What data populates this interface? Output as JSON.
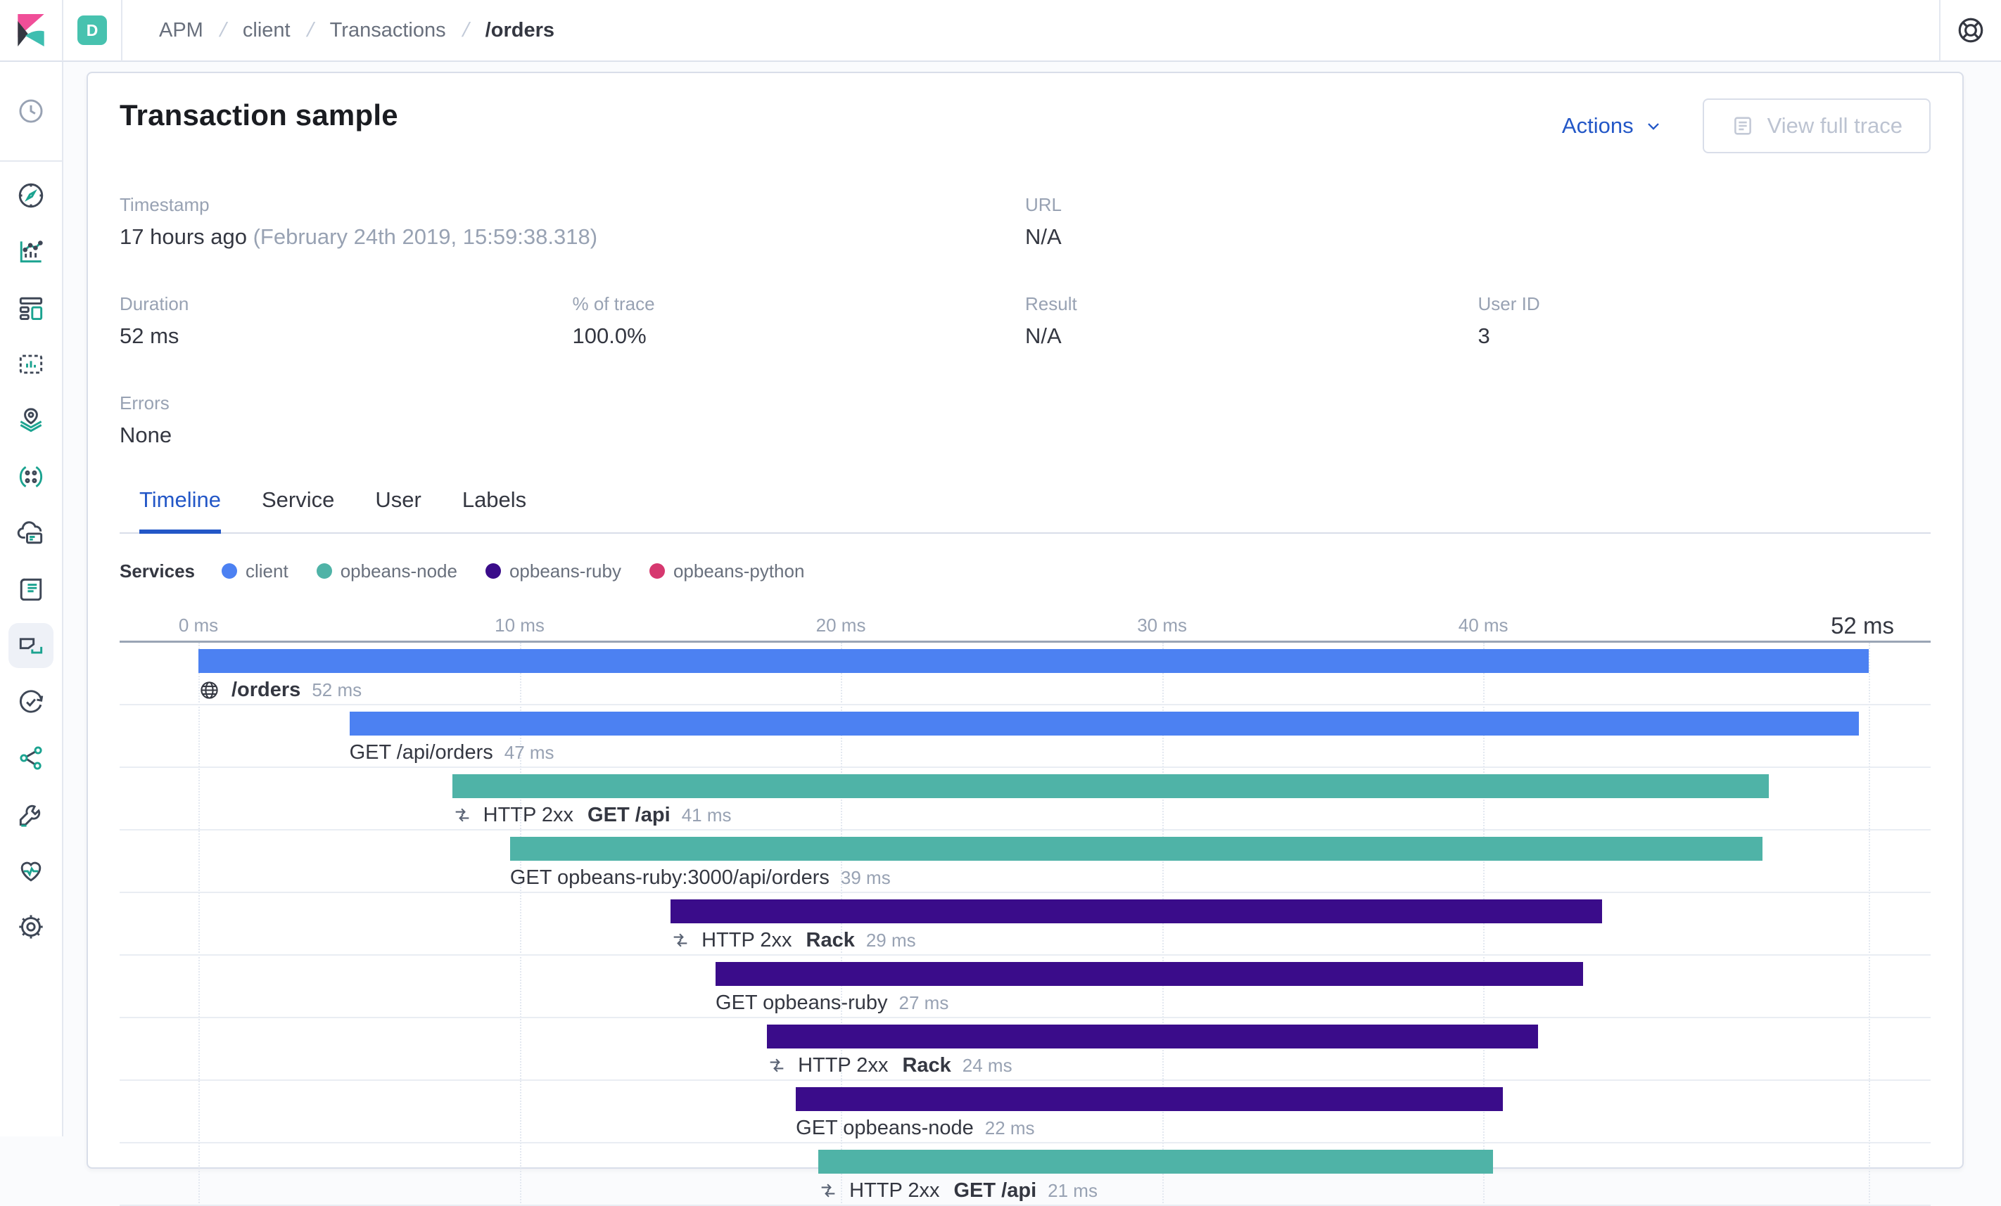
{
  "topbar": {
    "space_badge": "D",
    "breadcrumbs": [
      "APM",
      "client",
      "Transactions",
      "/orders"
    ]
  },
  "sidebar": {
    "items": [
      {
        "name": "recently-viewed",
        "icon": "clock"
      },
      {
        "name": "discover",
        "icon": "compass"
      },
      {
        "name": "visualize",
        "icon": "visualize"
      },
      {
        "name": "dashboard",
        "icon": "dashboard"
      },
      {
        "name": "canvas",
        "icon": "canvas"
      },
      {
        "name": "maps",
        "icon": "maps"
      },
      {
        "name": "machine-learning",
        "icon": "machine-learning"
      },
      {
        "name": "infrastructure",
        "icon": "infrastructure"
      },
      {
        "name": "logs",
        "icon": "logs"
      },
      {
        "name": "apm",
        "icon": "apm",
        "active": true
      },
      {
        "name": "uptime",
        "icon": "uptime"
      },
      {
        "name": "graph",
        "icon": "graph"
      },
      {
        "name": "dev-tools",
        "icon": "dev-tools"
      },
      {
        "name": "monitoring",
        "icon": "monitoring"
      },
      {
        "name": "management",
        "icon": "management"
      }
    ]
  },
  "panel": {
    "title": "Transaction sample",
    "actions_label": "Actions",
    "view_full_trace_label": "View full trace",
    "meta": {
      "timestamp": {
        "label": "Timestamp",
        "value": "17 hours ago",
        "value_secondary": "(February 24th 2019, 15:59:38.318)"
      },
      "url": {
        "label": "URL",
        "value": "N/A"
      },
      "duration": {
        "label": "Duration",
        "value": "52 ms"
      },
      "trace_pct": {
        "label": "% of trace",
        "value": "100.0%"
      },
      "result": {
        "label": "Result",
        "value": "N/A"
      },
      "user_id": {
        "label": "User ID",
        "value": "3"
      },
      "errors": {
        "label": "Errors",
        "value": "None"
      }
    }
  },
  "tabs": {
    "items": [
      {
        "label": "Timeline",
        "active": true
      },
      {
        "label": "Service",
        "active": false
      },
      {
        "label": "User",
        "active": false
      },
      {
        "label": "Labels",
        "active": false
      }
    ]
  },
  "timeline": {
    "legend_title": "Services",
    "legend": [
      {
        "label": "client",
        "color": "#4c81f2"
      },
      {
        "label": "opbeans-node",
        "color": "#4fb3a7"
      },
      {
        "label": "opbeans-ruby",
        "color": "#3a0c8a"
      },
      {
        "label": "opbeans-python",
        "color": "#d6386f"
      }
    ]
  },
  "colors": {
    "client": "#4c81f2",
    "opbeans-node": "#4fb3a7",
    "opbeans-ruby": "#3a0c8a",
    "opbeans-python": "#d6386f",
    "accent_blue": "#2357c7"
  },
  "chart_data": {
    "type": "bar",
    "subtype": "waterfall-gantt",
    "title": "Transaction timeline waterfall",
    "xlabel": "ms",
    "xlim": [
      0,
      52
    ],
    "grid": true,
    "ticks": [
      {
        "value": 0,
        "label": "0 ms"
      },
      {
        "value": 10,
        "label": "10 ms"
      },
      {
        "value": 20,
        "label": "20 ms"
      },
      {
        "value": 30,
        "label": "30 ms"
      },
      {
        "value": 40,
        "label": "40 ms"
      }
    ],
    "total_label": "52 ms",
    "items": [
      {
        "name": "/orders",
        "bold": true,
        "icon": "globe",
        "service": "client",
        "start_ms": 0,
        "duration_ms": 52,
        "duration_label": "52 ms"
      },
      {
        "name": "GET /api/orders",
        "service": "client",
        "start_ms": 4.7,
        "duration_ms": 47,
        "duration_label": "47 ms"
      },
      {
        "prefix": "HTTP 2xx",
        "name": "GET /api",
        "bold": true,
        "icon": "merge",
        "service": "opbeans-node",
        "start_ms": 7.9,
        "duration_ms": 41,
        "duration_label": "41 ms"
      },
      {
        "name": "GET opbeans-ruby:3000/api/orders",
        "service": "opbeans-node",
        "start_ms": 9.7,
        "duration_ms": 39,
        "duration_label": "39 ms"
      },
      {
        "prefix": "HTTP 2xx",
        "name": "Rack",
        "bold": true,
        "icon": "merge",
        "service": "opbeans-ruby",
        "start_ms": 14.7,
        "duration_ms": 29,
        "duration_label": "29 ms"
      },
      {
        "name": "GET opbeans-ruby",
        "service": "opbeans-ruby",
        "start_ms": 16.1,
        "duration_ms": 27,
        "duration_label": "27 ms"
      },
      {
        "prefix": "HTTP 2xx",
        "name": "Rack",
        "bold": true,
        "icon": "merge",
        "service": "opbeans-ruby",
        "start_ms": 17.7,
        "duration_ms": 24,
        "duration_label": "24 ms"
      },
      {
        "name": "GET opbeans-node",
        "service": "opbeans-ruby",
        "start_ms": 18.6,
        "duration_ms": 22,
        "duration_label": "22 ms"
      },
      {
        "prefix": "HTTP 2xx",
        "name": "GET /api",
        "bold": true,
        "icon": "merge",
        "service": "opbeans-node",
        "start_ms": 19.3,
        "duration_ms": 21,
        "duration_label": "21 ms"
      }
    ]
  }
}
